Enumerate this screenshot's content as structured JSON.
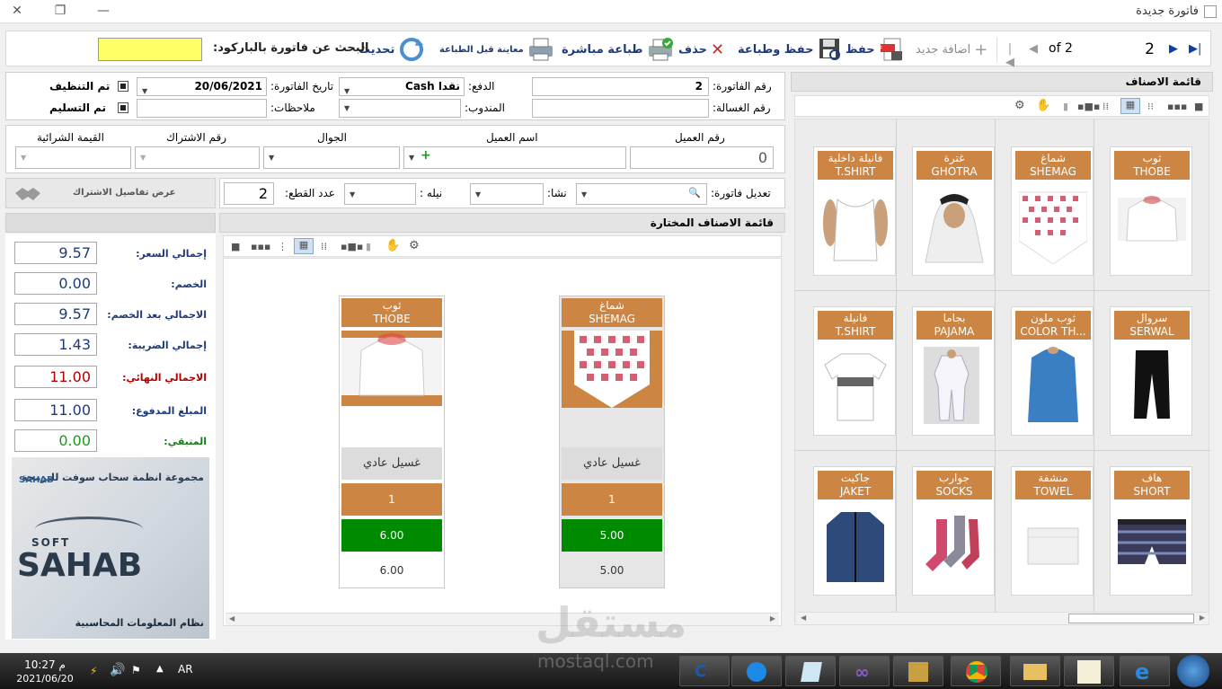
{
  "window": {
    "title": "فاتورة جديدة"
  },
  "toolbar": {
    "current_page": "2",
    "of_pages": "of 2",
    "add_new": "اضافة جديد",
    "save": "حفظ",
    "save_print": "حفظ وطباعة",
    "delete": "حذف",
    "direct_print": "طباعة مباشرة",
    "print_preview": "معاينة قبل الطباعة",
    "refresh": "تحديث",
    "barcode_search_label": "البحث عن فاتورة بالباركود:",
    "barcode_value": ""
  },
  "invoice": {
    "number_label": "رقم الفاتورة:",
    "number": "2",
    "payment_label": "الدفع:",
    "payment": "Cash نقدا",
    "date_label": "تاريخ الفاتورة:",
    "date": "20/06/2021",
    "cleaned_label": "تم التنظيف",
    "laundry_number_label": "رقم الغسالة:",
    "delegate_label": "المندوب:",
    "notes_label": "ملاحظات:",
    "delivered_label": "تم التسليم"
  },
  "customer": {
    "number_label": "رقم العميل",
    "number": "0",
    "name_label": "اسم العميل",
    "mobile_label": "الجوال",
    "subscription_label": "رقم الاشتراك",
    "purchase_value_label": "القيمة الشرائية"
  },
  "edit_row": {
    "edit_invoice_label": "تعديل فاتورة:",
    "starch_label": "نشا:",
    "indigo_label": "نيله :",
    "pieces_label": "عدد القطع:",
    "pieces": "2",
    "subscription_details": "عرض تفاصيل الاشتراك"
  },
  "selected_panel": {
    "title": "قائمة الاصناف المختارة",
    "items": [
      {
        "ar": "شماغ",
        "en": "SHEMAG",
        "wash": "غسيل عادي",
        "qty": "1",
        "price": "5.00",
        "total": "5.00"
      },
      {
        "ar": "ثوب",
        "en": "THOBE",
        "wash": "غسيل عادي",
        "qty": "1",
        "price": "6.00",
        "total": "6.00"
      }
    ]
  },
  "categories": {
    "title": "قائمة الاصناف",
    "items": [
      {
        "ar": "ثوب",
        "en": "THOBE"
      },
      {
        "ar": "شماغ",
        "en": "SHEMAG"
      },
      {
        "ar": "غترة",
        "en": "GHOTRA"
      },
      {
        "ar": "فانيلة داخلية",
        "en": "T.SHIRT"
      },
      {
        "ar": "سروال",
        "en": "SERWAL"
      },
      {
        "ar": "ثوب ملون",
        "en": "COLOR TH..."
      },
      {
        "ar": "بجاما",
        "en": "PAJAMA"
      },
      {
        "ar": "فانيلة",
        "en": "T.SHIRT"
      },
      {
        "ar": "هاف",
        "en": "SHORT"
      },
      {
        "ar": "منشفة",
        "en": "TOWEL"
      },
      {
        "ar": "جوارب",
        "en": "SOCKS"
      },
      {
        "ar": "جاكيت",
        "en": "JAKET"
      }
    ]
  },
  "totals": {
    "price_label": "إجمالي السعر:",
    "price": "9.57",
    "discount_label": "الخصم:",
    "discount": "0.00",
    "after_discount_label": "الاجمالي بعد الخصم:",
    "after_discount": "9.57",
    "tax_label": "إجمالي الضريبة:",
    "tax": "1.43",
    "final_label": "الاجمالي النهائي:",
    "final": "11.00",
    "paid_label": "المبلغ المدفوع:",
    "paid": "11.00",
    "remaining_label": "المتبقي:",
    "remaining": "0.00"
  },
  "branding": {
    "group_text": "مجموعة انظمة سحاب سوفت للبرمجة",
    "system_text": "نظام المعلومات المحاسبية",
    "logo_small": "SAHAB",
    "logo_soft": "SOFT",
    "logo_big": "SAHAB"
  },
  "watermark": {
    "ar": "مستقل",
    "url": "mostaql.com"
  },
  "taskbar": {
    "time": "10:27 م",
    "date": "2021/06/20",
    "lang": "AR"
  },
  "colors": {
    "accent_orange": "#cd8543",
    "price_green": "#008a00",
    "final_red": "#b00000",
    "label_blue": "#1f3a7a",
    "barcode_yellow": "#ffff66"
  }
}
